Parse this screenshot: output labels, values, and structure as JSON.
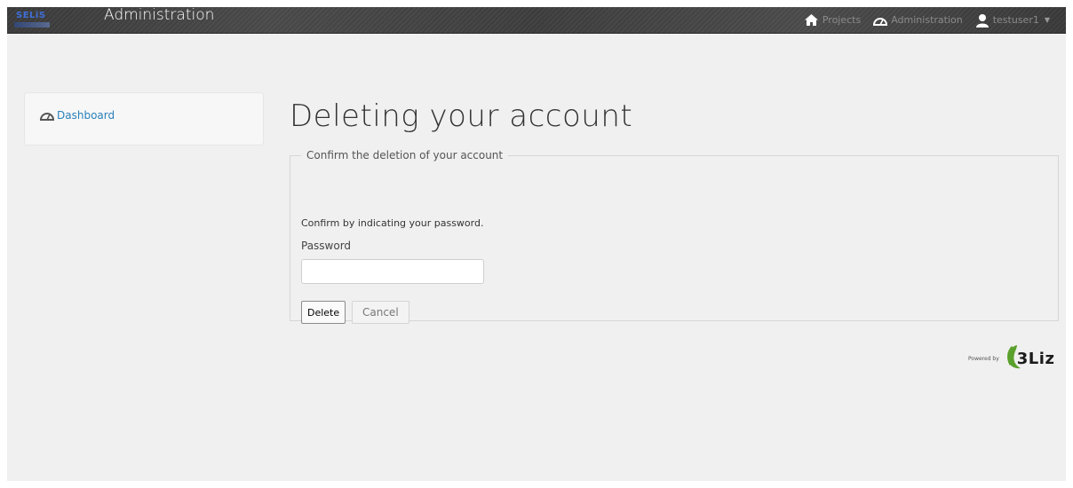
{
  "header": {
    "logo_text": "SELiS",
    "app_title": "Administration",
    "nav": [
      {
        "label": "Projects",
        "icon": "home-icon"
      },
      {
        "label": "Administration",
        "icon": "dashboard-icon"
      },
      {
        "label": "testuser1",
        "icon": "user-icon"
      }
    ]
  },
  "sidebar": {
    "items": [
      {
        "label": "Dashboard",
        "icon": "dashboard-icon"
      }
    ]
  },
  "main": {
    "title": "Deleting your account",
    "form": {
      "legend": "Confirm the deletion of your account",
      "hint": "Confirm by indicating your password.",
      "password_label": "Password",
      "password_value": "",
      "delete_label": "Delete",
      "cancel_label": "Cancel"
    }
  },
  "footer": {
    "powered_by": "Powered by",
    "brand": "3Liz"
  },
  "colors": {
    "link": "#2a80b9",
    "brand_green": "#5aa02c",
    "topbar": "#3e3e3e"
  }
}
